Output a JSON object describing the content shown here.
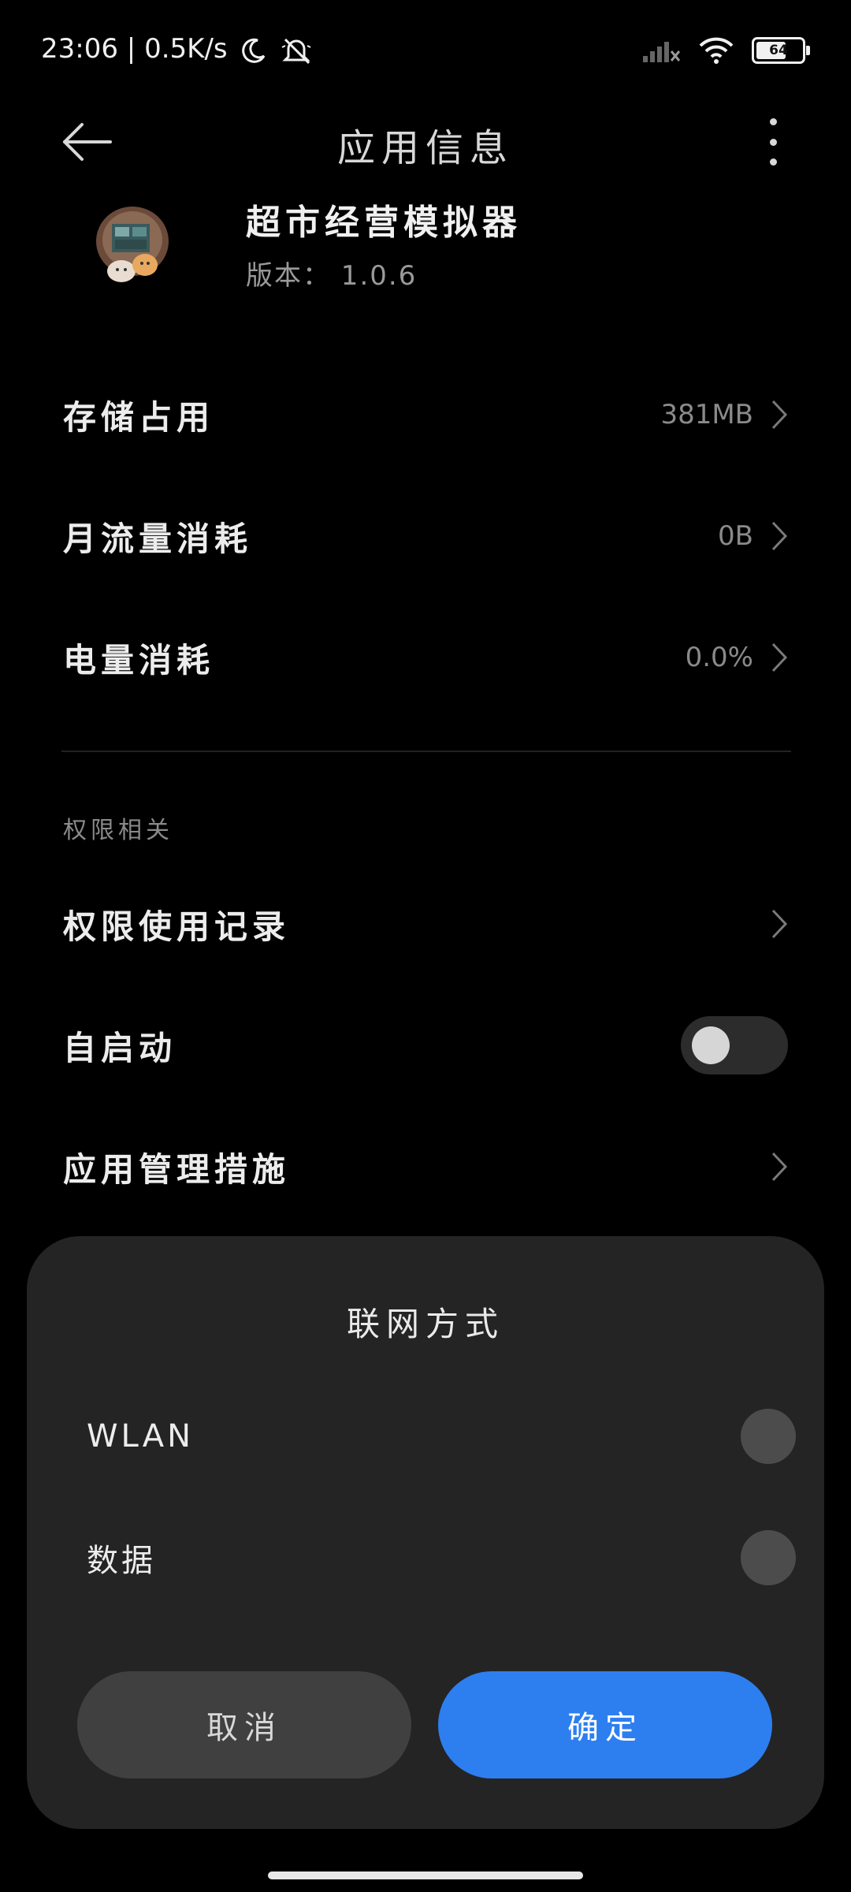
{
  "status_bar": {
    "time": "23:06",
    "separator": "|",
    "net_speed": "0.5K/s",
    "icons": [
      "moon-icon",
      "mute-icon",
      "signal-icon",
      "wifi-icon",
      "battery-icon"
    ],
    "battery": "64"
  },
  "header": {
    "title": "应用信息",
    "back_icon": "arrow-left-icon",
    "more_icon": "more-vertical-icon"
  },
  "app": {
    "name": "超市经营模拟器",
    "version": "版本： 1.0.6"
  },
  "rows": [
    {
      "label": "存储占用",
      "value": "381MB"
    },
    {
      "label": "月流量消耗",
      "value": "0B"
    },
    {
      "label": "电量消耗",
      "value": "0.0%"
    }
  ],
  "permissions": {
    "section_title": "权限相关",
    "items": [
      {
        "label": "权限使用记录"
      },
      {
        "label": "自启动",
        "toggle": false
      },
      {
        "label": "应用管理措施"
      }
    ]
  },
  "dialog": {
    "title": "联网方式",
    "options": [
      {
        "label": "WLAN",
        "selected": false
      },
      {
        "label": "数据",
        "selected": false
      }
    ],
    "cancel": "取消",
    "confirm": "确定"
  },
  "colors": {
    "accent": "#2d7ff0",
    "background": "#000000",
    "sheet": "#242424"
  }
}
